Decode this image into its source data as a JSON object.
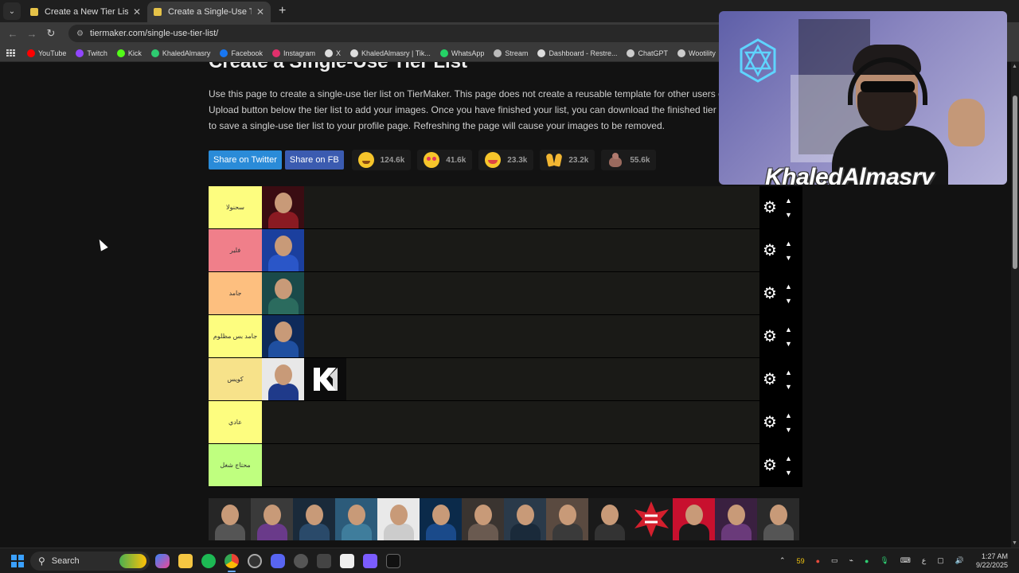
{
  "browser": {
    "tabs": [
      {
        "title": "Create a New Tier List - TierMaker",
        "active": false
      },
      {
        "title": "Create a Single-Use Tier List (Pro",
        "active": true
      }
    ],
    "url": "tiermaker.com/single-use-tier-list/",
    "bookmarks": [
      {
        "label": "YouTube",
        "color": "#ff0000"
      },
      {
        "label": "Twitch",
        "color": "#9146ff"
      },
      {
        "label": "Kick",
        "color": "#53fc18"
      },
      {
        "label": "KhaledAlmasry",
        "color": "#2ecc71"
      },
      {
        "label": "Facebook",
        "color": "#1877f2"
      },
      {
        "label": "Instagram",
        "color": "#e1306c"
      },
      {
        "label": "X",
        "color": "#dddddd"
      },
      {
        "label": "KhaledAlmasry | Tik...",
        "color": "#dddddd"
      },
      {
        "label": "WhatsApp",
        "color": "#25d366"
      },
      {
        "label": "Stream",
        "color": "#bbbbbb"
      },
      {
        "label": "Dashboard - Restre...",
        "color": "#dddddd"
      },
      {
        "label": "ChatGPT",
        "color": "#cccccc"
      },
      {
        "label": "Wootility",
        "color": "#cccccc"
      },
      {
        "label": "KhaledAlma...",
        "color": "#4a90e2"
      }
    ]
  },
  "page": {
    "title": "Create a Single-Use Tier List",
    "description": [
      "Use this page to create a single-use tier list on TierMaker. This page does not create a reusable template for other users of the w",
      "Upload button below the tier list to add your images. Once you have finished your list, you can download the finished tier list ima",
      "to save a single-use tier list to your profile page. Refreshing the page will cause your images to be removed."
    ],
    "share_twitter": "Share on Twitter",
    "share_fb": "Share on FB",
    "reactions": [
      {
        "icon": "grinning-face-icon",
        "count": "124.6k"
      },
      {
        "icon": "heart-eyes-icon",
        "count": "41.6k"
      },
      {
        "icon": "laughing-face-icon",
        "count": "23.3k"
      },
      {
        "icon": "raised-hands-icon",
        "count": "23.2k"
      },
      {
        "icon": "poop-icon",
        "count": "55.6k"
      }
    ]
  },
  "tiers": [
    {
      "label": "سحنولا",
      "color": "#fdfd7f",
      "items": 1
    },
    {
      "label": "فلير",
      "color": "#f07f8a",
      "items": 1
    },
    {
      "label": "جامد",
      "color": "#fdbf7f",
      "items": 1
    },
    {
      "label": "جامد بس مظلوم",
      "color": "#fdfd7f",
      "items": 1
    },
    {
      "label": "كويس",
      "color": "#f7e28a",
      "items": 2
    },
    {
      "label": "عادي",
      "color": "#fdfd7f",
      "items": 0
    },
    {
      "label": "محتاج شغل",
      "color": "#bfff7f",
      "items": 0
    }
  ],
  "pool_count": 14,
  "webcam": {
    "streamer_name": "KhaledAlmasry"
  },
  "taskbar": {
    "search_label": "Search",
    "tray_num": "59",
    "lang": "ع",
    "time": "1:27 AM",
    "date": "9/22/2025"
  }
}
